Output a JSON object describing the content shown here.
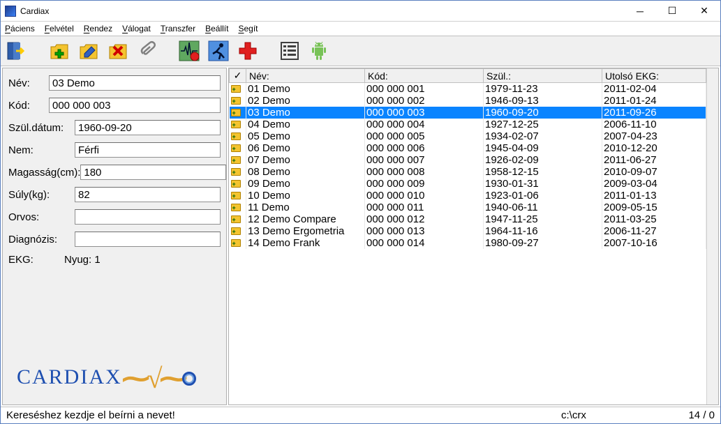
{
  "window": {
    "title": "Cardiax"
  },
  "menu": {
    "items": [
      "Páciens",
      "Felvétel",
      "Rendez",
      "Válogat",
      "Transzfer",
      "Beállít",
      "Segít"
    ]
  },
  "toolbar_icons": [
    "exit",
    "folder-new",
    "folder-edit",
    "folder-delete",
    "attach",
    "ekg-record",
    "ergo-run",
    "medical-cross",
    "list-form",
    "android"
  ],
  "panel": {
    "labels": {
      "name": "Név:",
      "code": "Kód:",
      "dob": "Szül.dátum:",
      "sex": "Nem:",
      "height": "Magasság(cm):",
      "weight": "Súly(kg):",
      "doctor": "Orvos:",
      "diag": "Diagnózis:",
      "ekg": "EKG:",
      "ekg_val": "Nyug: 1"
    },
    "values": {
      "name": "03 Demo",
      "code": "000 000 003",
      "dob": "1960-09-20",
      "sex": "Férfi",
      "height": "180",
      "weight": "82",
      "doctor": "",
      "diag": ""
    },
    "logo": "CARDIAX"
  },
  "table": {
    "headers": {
      "check": "✓",
      "name": "Név:",
      "code": "Kód:",
      "dob": "Szül.:",
      "last": "Utolsó EKG:"
    },
    "rows": [
      {
        "name": "01 Demo",
        "code": "000 000 001",
        "dob": "1979-11-23",
        "last": "2011-02-04"
      },
      {
        "name": "02 Demo",
        "code": "000 000 002",
        "dob": "1946-09-13",
        "last": "2011-01-24"
      },
      {
        "name": "03 Demo",
        "code": "000 000 003",
        "dob": "1960-09-20",
        "last": "2011-09-26",
        "selected": true
      },
      {
        "name": "04 Demo",
        "code": "000 000 004",
        "dob": "1927-12-25",
        "last": "2006-11-10"
      },
      {
        "name": "05 Demo",
        "code": "000 000 005",
        "dob": "1934-02-07",
        "last": "2007-04-23"
      },
      {
        "name": "06 Demo",
        "code": "000 000 006",
        "dob": "1945-04-09",
        "last": "2010-12-20"
      },
      {
        "name": "07 Demo",
        "code": "000 000 007",
        "dob": "1926-02-09",
        "last": "2011-06-27"
      },
      {
        "name": "08 Demo",
        "code": "000 000 008",
        "dob": "1958-12-15",
        "last": "2010-09-07"
      },
      {
        "name": "09 Demo",
        "code": "000 000 009",
        "dob": "1930-01-31",
        "last": "2009-03-04"
      },
      {
        "name": "10 Demo",
        "code": "000 000 010",
        "dob": "1923-01-06",
        "last": "2011-01-13"
      },
      {
        "name": "11 Demo",
        "code": "000 000 011",
        "dob": "1940-06-11",
        "last": "2009-05-15"
      },
      {
        "name": "12 Demo Compare",
        "code": "000 000 012",
        "dob": "1947-11-25",
        "last": "2011-03-25"
      },
      {
        "name": "13 Demo Ergometria",
        "code": "000 000 013",
        "dob": "1964-11-16",
        "last": "2006-11-27"
      },
      {
        "name": "14 Demo Frank",
        "code": "000 000 014",
        "dob": "1980-09-27",
        "last": "2007-10-16"
      }
    ]
  },
  "status": {
    "hint": "Kereséshez kezdje el beírni a nevet!",
    "path": "c:\\crx",
    "count": "14 / 0"
  }
}
